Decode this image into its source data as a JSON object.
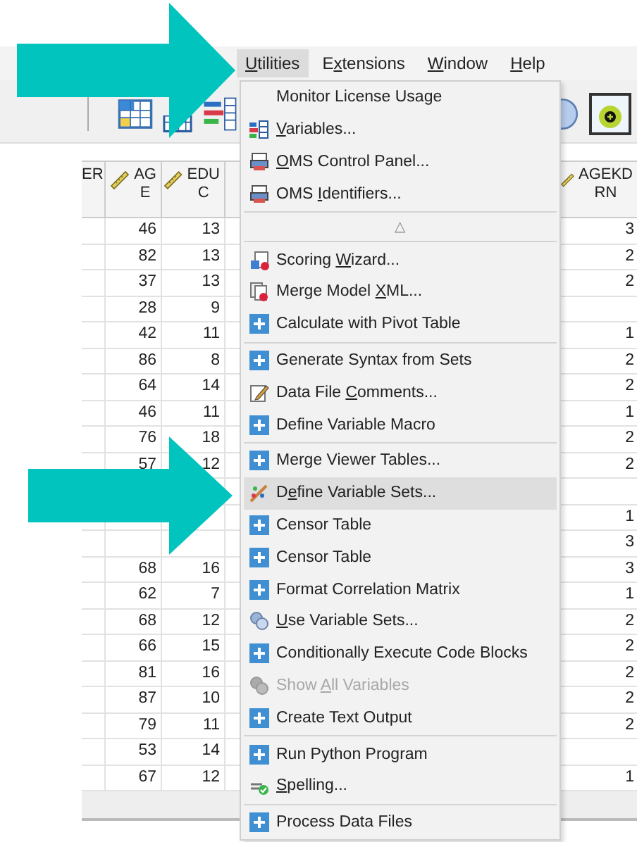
{
  "menubar": [
    {
      "label_parts": [
        {
          "text": "U",
          "underline": true
        },
        {
          "text": "tilities",
          "underline": false
        }
      ],
      "selected": true
    },
    {
      "label_parts": [
        {
          "text": "E",
          "underline": false
        },
        {
          "text": "x",
          "underline": true
        },
        {
          "text": "tensions",
          "underline": false
        }
      ],
      "selected": false
    },
    {
      "label_parts": [
        {
          "text": "W",
          "underline": true
        },
        {
          "text": "indow",
          "underline": false
        }
      ],
      "selected": false
    },
    {
      "label_parts": [
        {
          "text": "H",
          "underline": true
        },
        {
          "text": "elp",
          "underline": false
        }
      ],
      "selected": false
    }
  ],
  "table": {
    "columns": [
      {
        "lines": [
          "ER"
        ],
        "icon": false
      },
      {
        "lines": [
          "AG",
          "E"
        ],
        "icon": true
      },
      {
        "lines": [
          "EDU",
          "C"
        ],
        "icon": true
      },
      {
        "lines": [
          "AGEKD",
          "RN"
        ],
        "icon": true
      }
    ],
    "rows": [
      {
        "age": "46",
        "educ": "13",
        "agekdrn": "3"
      },
      {
        "age": "82",
        "educ": "13",
        "agekdrn": "2"
      },
      {
        "age": "37",
        "educ": "13",
        "agekdrn": "2"
      },
      {
        "age": "28",
        "educ": "9"
      },
      {
        "age": "42",
        "educ": "11",
        "agekdrn": "1"
      },
      {
        "age": "86",
        "educ": "8",
        "agekdrn": "2"
      },
      {
        "age": "64",
        "educ": "14",
        "agekdrn": "2"
      },
      {
        "age": "46",
        "educ": "11",
        "agekdrn": "1"
      },
      {
        "age": "76",
        "educ": "18",
        "agekdrn": "2"
      },
      {
        "age": "57",
        "educ": "12",
        "agekdrn": "2"
      },
      {},
      {
        "agekdrn": "1"
      },
      {
        "agekdrn": "3"
      },
      {
        "age": "68",
        "educ": "16",
        "agekdrn": "3"
      },
      {
        "age": "62",
        "educ": "7",
        "agekdrn": "1"
      },
      {
        "age": "68",
        "educ": "12",
        "agekdrn": "2"
      },
      {
        "age": "66",
        "educ": "15",
        "agekdrn": "2"
      },
      {
        "age": "81",
        "educ": "16",
        "agekdrn": "2"
      },
      {
        "age": "87",
        "educ": "10",
        "agekdrn": "2"
      },
      {
        "age": "79",
        "educ": "11",
        "agekdrn": "2"
      },
      {
        "age": "53",
        "educ": "14"
      },
      {
        "age": "67",
        "educ": "12",
        "agekdrn": "1"
      }
    ]
  },
  "menu": [
    {
      "kind": "plain",
      "label_parts": [
        {
          "text": "Monitor License Usage",
          "underline": false
        }
      ],
      "disabled": false,
      "selected": false
    },
    {
      "kind": "grid",
      "label_parts": [
        {
          "text": "V",
          "underline": true
        },
        {
          "text": "ariables...",
          "underline": false
        }
      ],
      "disabled": false,
      "selected": false
    },
    {
      "kind": "printer",
      "label_parts": [
        {
          "text": "O",
          "underline": true
        },
        {
          "text": "MS Control Panel...",
          "underline": false
        }
      ],
      "disabled": false,
      "selected": false
    },
    {
      "kind": "printer",
      "label_parts": [
        {
          "text": "OMS ",
          "underline": false
        },
        {
          "text": "I",
          "underline": true
        },
        {
          "text": "dentifiers...",
          "underline": false
        }
      ],
      "disabled": false,
      "selected": false
    },
    {
      "kind": "separator"
    },
    {
      "kind": "scroll",
      "glyph": "△"
    },
    {
      "kind": "separator"
    },
    {
      "kind": "wizard",
      "label_parts": [
        {
          "text": "Scoring ",
          "underline": false
        },
        {
          "text": "W",
          "underline": true
        },
        {
          "text": "izard...",
          "underline": false
        }
      ],
      "disabled": false,
      "selected": false
    },
    {
      "kind": "document",
      "label_parts": [
        {
          "text": "Merge Model ",
          "underline": false
        },
        {
          "text": "X",
          "underline": true
        },
        {
          "text": "ML...",
          "underline": false
        }
      ],
      "disabled": false,
      "selected": false
    },
    {
      "kind": "plus",
      "label_parts": [
        {
          "text": "Calculate with Pivot Table",
          "underline": false
        }
      ],
      "disabled": false,
      "selected": false
    },
    {
      "kind": "separator"
    },
    {
      "kind": "plus",
      "label_parts": [
        {
          "text": "Generate Syntax from Sets",
          "underline": false
        }
      ],
      "disabled": false,
      "selected": false
    },
    {
      "kind": "pencil",
      "label_parts": [
        {
          "text": "Data File ",
          "underline": false
        },
        {
          "text": "C",
          "underline": true
        },
        {
          "text": "omments...",
          "underline": false
        }
      ],
      "disabled": false,
      "selected": false
    },
    {
      "kind": "plus",
      "label_parts": [
        {
          "text": "Define Variable Macro",
          "underline": false
        }
      ],
      "disabled": false,
      "selected": false
    },
    {
      "kind": "separator"
    },
    {
      "kind": "plus",
      "label_parts": [
        {
          "text": "Merge Viewer Tables...",
          "underline": false
        }
      ],
      "disabled": false,
      "selected": false
    },
    {
      "kind": "wand",
      "label_parts": [
        {
          "text": "D",
          "underline": false
        },
        {
          "text": "e",
          "underline": true
        },
        {
          "text": "fine Variable Sets...",
          "underline": false
        }
      ],
      "disabled": false,
      "selected": true
    },
    {
      "kind": "plus",
      "label_parts": [
        {
          "text": "Censor Table",
          "underline": false
        }
      ],
      "disabled": false,
      "selected": false
    },
    {
      "kind": "plus",
      "label_parts": [
        {
          "text": "Censor Table",
          "underline": false
        }
      ],
      "disabled": false,
      "selected": false
    },
    {
      "kind": "plus",
      "label_parts": [
        {
          "text": "Format Correlation Matrix",
          "underline": false
        }
      ],
      "disabled": false,
      "selected": false
    },
    {
      "kind": "circles",
      "label_parts": [
        {
          "text": "U",
          "underline": true
        },
        {
          "text": "se Variable Sets...",
          "underline": false
        }
      ],
      "disabled": false,
      "selected": false
    },
    {
      "kind": "plus",
      "label_parts": [
        {
          "text": "Conditionally Execute Code Blocks",
          "underline": false
        }
      ],
      "disabled": false,
      "selected": false
    },
    {
      "kind": "circles",
      "label_parts": [
        {
          "text": "Show ",
          "underline": false
        },
        {
          "text": "A",
          "underline": true
        },
        {
          "text": "ll Variables",
          "underline": false
        }
      ],
      "disabled": true,
      "selected": false
    },
    {
      "kind": "plus",
      "label_parts": [
        {
          "text": "Create Text Output",
          "underline": false
        }
      ],
      "disabled": false,
      "selected": false
    },
    {
      "kind": "separator"
    },
    {
      "kind": "plus",
      "label_parts": [
        {
          "text": "Run Python Program",
          "underline": false
        }
      ],
      "disabled": false,
      "selected": false
    },
    {
      "kind": "check",
      "label_parts": [
        {
          "text": "S",
          "underline": true
        },
        {
          "text": "pelling...",
          "underline": false
        }
      ],
      "disabled": false,
      "selected": false
    },
    {
      "kind": "separator"
    },
    {
      "kind": "plus",
      "label_parts": [
        {
          "text": "Process Data Files",
          "underline": false
        }
      ],
      "disabled": false,
      "selected": false
    }
  ]
}
